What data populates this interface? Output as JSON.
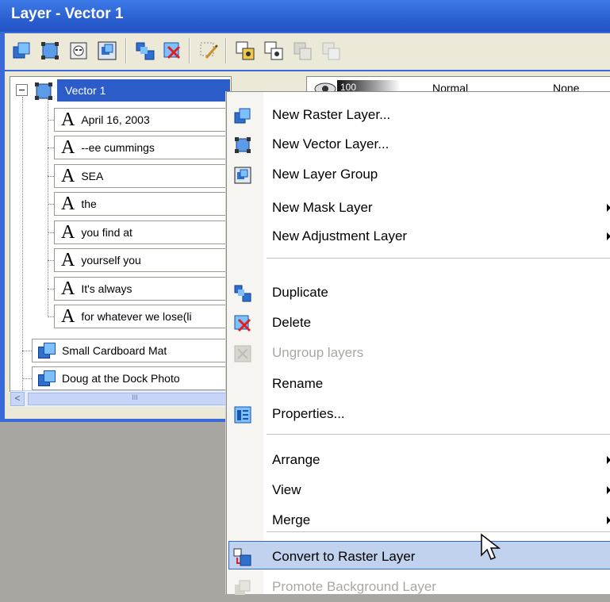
{
  "window": {
    "title": "Layer - Vector 1"
  },
  "toolbar": {
    "icons": [
      "new-raster-layer-icon",
      "new-vector-layer-icon",
      "new-mask-layer-icon",
      "new-layer-group-icon",
      "duplicate-layer-icon",
      "delete-layer-icon",
      "edit-selection-icon",
      "view-overlay-icon",
      "highlight-layer-icon",
      "link-layer-icon",
      "lock-transparency-icon"
    ]
  },
  "tree": {
    "root": "Vector 1",
    "text_layers": [
      "April 16, 2003",
      "--ee cummings",
      "SEA",
      "the",
      "you find at",
      "yourself you",
      "It's always",
      "for whatever we lose(li"
    ],
    "layers": [
      "Small Cardboard Mat",
      "Doug at the Dock Photo"
    ],
    "scroll_thumb": "III"
  },
  "props": {
    "opacity": "100",
    "blend": "Normal",
    "overlay": "None"
  },
  "menu": {
    "items": [
      {
        "label": "New Raster Layer...",
        "icon": "new-raster-layer-icon"
      },
      {
        "label": "New Vector Layer...",
        "icon": "new-vector-layer-icon"
      },
      {
        "label": "New Layer Group",
        "icon": "new-layer-group-icon"
      },
      {
        "label": "New Mask Layer",
        "submenu": true
      },
      {
        "label": "New Adjustment Layer",
        "submenu": true
      },
      {
        "label": "Duplicate",
        "icon": "duplicate-icon"
      },
      {
        "label": "Delete",
        "icon": "delete-icon"
      },
      {
        "label": "Ungroup layers",
        "disabled": true,
        "icon": "ungroup-icon"
      },
      {
        "label": "Rename"
      },
      {
        "label": "Properties...",
        "icon": "properties-icon"
      },
      {
        "label": "Arrange",
        "submenu": true
      },
      {
        "label": "View",
        "submenu": true
      },
      {
        "label": "Merge",
        "submenu": true
      },
      {
        "label": "Convert to Raster Layer",
        "highlighted": true,
        "icon": "convert-raster-icon"
      },
      {
        "label": "Promote Background Layer",
        "disabled": true,
        "icon": "promote-background-icon"
      }
    ]
  },
  "colors": {
    "title_bar": "#2a5fd0",
    "selection": "#2c5cc7",
    "menu_highlight": "#c1d2ee"
  }
}
